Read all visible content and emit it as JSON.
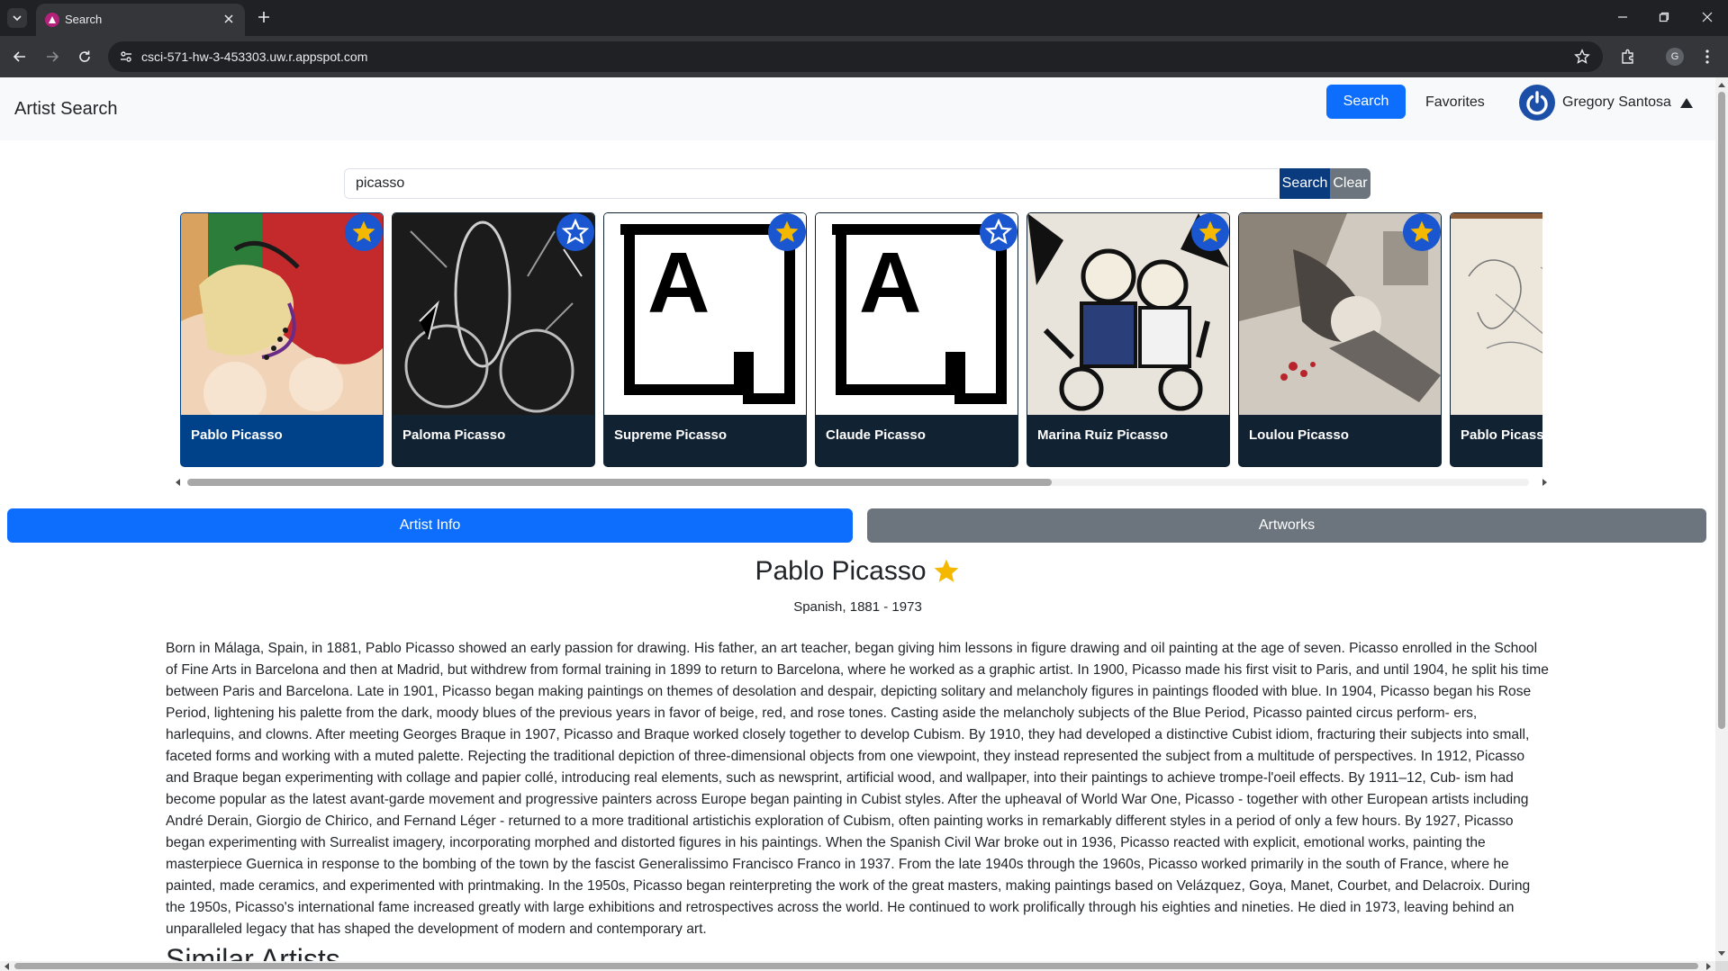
{
  "browser": {
    "tab_title": "Search",
    "url": "csci-571-hw-3-453303.uw.r.appspot.com",
    "profile_initial": "G"
  },
  "navbar": {
    "brand": "Artist Search",
    "search_label": "Search",
    "favorites_label": "Favorites",
    "user_name": "Gregory Santosa"
  },
  "search": {
    "query": "picasso",
    "search_button": "Search",
    "clear_button": "Clear"
  },
  "results": [
    {
      "name": "Pablo Picasso",
      "favorited": true,
      "active": true,
      "image": "sleeping-woman-painting"
    },
    {
      "name": "Paloma Picasso",
      "favorited": false,
      "active": false,
      "image": "etching-figures"
    },
    {
      "name": "Supreme Picasso",
      "favorited": true,
      "active": false,
      "image": "artsy-logo-placeholder"
    },
    {
      "name": "Claude Picasso",
      "favorited": false,
      "active": false,
      "image": "artsy-logo-placeholder"
    },
    {
      "name": "Marina Ruiz Picasso",
      "favorited": true,
      "active": false,
      "image": "children-painting"
    },
    {
      "name": "Loulou Picasso",
      "favorited": true,
      "active": false,
      "image": "collage-photo"
    },
    {
      "name": "Pablo Picass",
      "favorited": false,
      "active": false,
      "image": "pencil-sketch"
    }
  ],
  "tabs": {
    "artist_info": "Artist Info",
    "artworks": "Artworks"
  },
  "artist": {
    "name": "Pablo Picasso",
    "favorited": true,
    "meta": "Spanish, 1881 - 1973",
    "biography": "Born in Málaga, Spain, in 1881, Pablo Picasso showed an early passion for drawing. His father, an art teacher, began giving him lessons in figure drawing and oil painting at the age of seven. Picasso enrolled in the School of Fine Arts in Barcelona and then at Madrid, but withdrew from formal training in 1899 to return to Barcelona, where he worked as a graphic artist. In 1900, Picasso made his first visit to Paris, and until 1904, he split his time between Paris and Barcelona. Late in 1901, Picasso began making paintings on themes of desolation and despair, depicting solitary and melancholy figures in paintings flooded with blue. In 1904, Picasso began his Rose Period, lightening his palette from the dark, moody blues of the previous years in favor of beige, red, and rose tones. Casting aside the melancholy subjects of the Blue Period, Picasso painted circus perform- ers, harlequins, and clowns. After meeting Georges Braque in 1907, Picasso and Braque worked closely together to develop Cubism. By 1910, they had developed a distinctive Cubist idiom, fracturing their subjects into small, faceted forms and working with a muted palette. Rejecting the traditional depiction of three-dimensional objects from one viewpoint, they instead represented the subject from a multitude of perspectives. In 1912, Picasso and Braque began experimenting with collage and papier collé, introducing real elements, such as newsprint, artificial wood, and wallpaper, into their paintings to achieve trompe-l'oeil effects. By 1911–12, Cub- ism had become popular as the latest avant-garde movement and progressive painters across Europe began painting in Cubist styles. After the upheaval of World War One, Picasso - together with other European artists including André Derain, Giorgio de Chirico, and Fernand Léger - returned to a more traditional artistichis exploration of Cubism, often painting works in remarkably different styles in a period of only a few hours. By 1927, Picasso began experimenting with Surrealist imagery, incorporating morphed and distorted figures in his paintings. When the Spanish Civil War broke out in 1936, Picasso reacted with explicit, emotional works, painting the masterpiece Guernica in response to the bombing of the town by the fascist Generalissimo Francisco Franco in 1937. From the late 1940s through the 1960s, Picasso worked primarily in the south of France, where he painted, made ceramics, and experimented with printmaking. In the 1950s, Picasso began reinterpreting the work of the great masters, making paintings based on Velázquez, Goya, Manet, Courbet, and Delacroix. During the 1950s, Picasso's international fame increased greatly with large exhibitions and retrospectives across the world. He continued to work prolifically through his eighties and nineties. He died in 1973, leaving behind an unparalleled legacy that has shaped the development of modern and contemporary art."
  },
  "similar_heading": "Similar Artists",
  "colors": {
    "primary": "#0d6efd",
    "card_bg": "#112233",
    "card_active": "#00428a",
    "secondary": "#6c757d",
    "star_gold": "#f5b800"
  }
}
